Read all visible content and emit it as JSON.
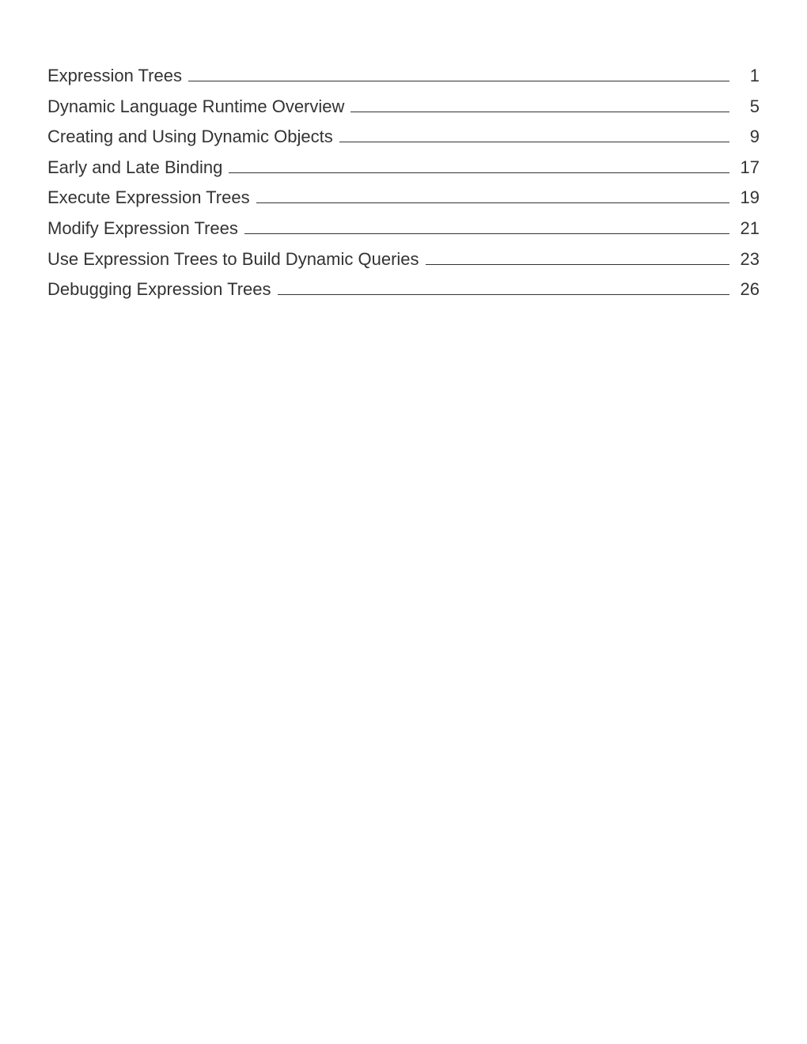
{
  "toc": {
    "entries": [
      {
        "title": "Expression Trees",
        "page": "1"
      },
      {
        "title": "Dynamic Language Runtime Overview",
        "page": "5"
      },
      {
        "title": "Creating and Using Dynamic Objects",
        "page": "9"
      },
      {
        "title": "Early and Late Binding",
        "page": "17"
      },
      {
        "title": "Execute Expression Trees",
        "page": "19"
      },
      {
        "title": "Modify Expression Trees",
        "page": "21"
      },
      {
        "title": "Use Expression Trees to Build Dynamic Queries",
        "page": "23"
      },
      {
        "title": "Debugging Expression Trees",
        "page": "26"
      }
    ]
  }
}
